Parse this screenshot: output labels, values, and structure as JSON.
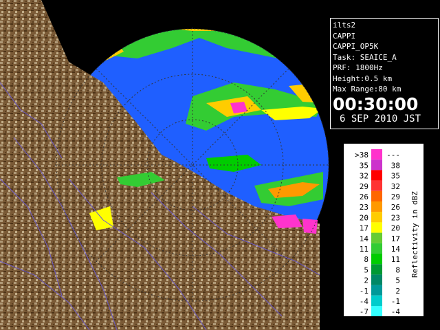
{
  "info": {
    "radar": "ilts2",
    "product": "CAPPI",
    "product_code": "CAPPI_OP5K",
    "task": "Task: SEAICE_A",
    "prf": "PRF: 1800Hz",
    "height": "Height:0.5 km",
    "max_range": "Max Range:80 km",
    "time": "00:30:00",
    "date": "6 SEP 2010 JST"
  },
  "legend": {
    "title": "Reflectivity in dBZ",
    "rows": [
      {
        "low": ">38",
        "high": "---",
        "color": "#ff33cc"
      },
      {
        "low": "35",
        "high": "38",
        "color": "#cc33cc"
      },
      {
        "low": "32",
        "high": "35",
        "color": "#ff0000"
      },
      {
        "low": "29",
        "high": "32",
        "color": "#ff3333"
      },
      {
        "low": "26",
        "high": "29",
        "color": "#ff6600"
      },
      {
        "low": "23",
        "high": "26",
        "color": "#ff9900"
      },
      {
        "low": "20",
        "high": "23",
        "color": "#ffcc00"
      },
      {
        "low": "17",
        "high": "20",
        "color": "#ffff00"
      },
      {
        "low": "14",
        "high": "17",
        "color": "#66cc33"
      },
      {
        "low": "11",
        "high": "14",
        "color": "#33cc33"
      },
      {
        "low": "8",
        "high": "11",
        "color": "#00cc00"
      },
      {
        "low": "5",
        "high": "8",
        "color": "#009933"
      },
      {
        "low": "2",
        "high": "5",
        "color": "#008866"
      },
      {
        "low": "-1",
        "high": "2",
        "color": "#009999"
      },
      {
        "low": "-4",
        "high": "-1",
        "color": "#00cccc"
      },
      {
        "low": "-7",
        "high": "-4",
        "color": "#33ffff"
      }
    ]
  },
  "colors": {
    "sea": "#1f5fff",
    "land_dark": "#6b4a2a",
    "land_light": "#b09a78",
    "background": "#000000"
  }
}
